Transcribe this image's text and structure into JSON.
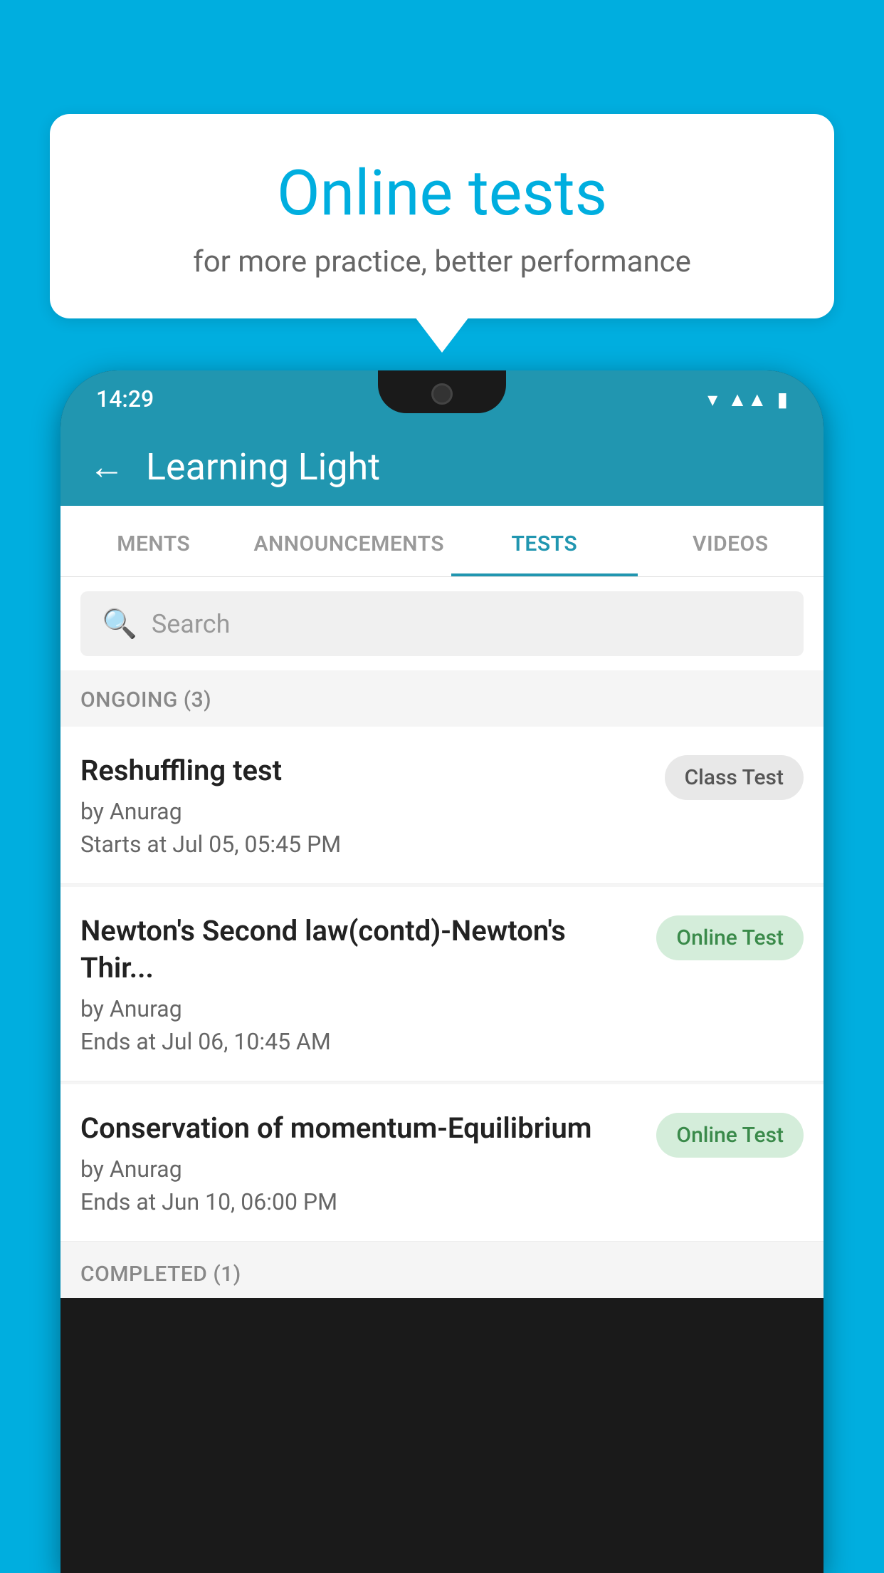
{
  "background": {
    "color": "#00AEDF"
  },
  "speech_bubble": {
    "title": "Online tests",
    "subtitle": "for more practice, better performance"
  },
  "phone": {
    "status_bar": {
      "time": "14:29",
      "icons": [
        "wifi",
        "signal",
        "battery"
      ]
    },
    "app_bar": {
      "title": "Learning Light",
      "back_label": "←"
    },
    "tabs": [
      {
        "label": "MENTS",
        "active": false
      },
      {
        "label": "ANNOUNCEMENTS",
        "active": false
      },
      {
        "label": "TESTS",
        "active": true
      },
      {
        "label": "VIDEOS",
        "active": false
      }
    ],
    "search": {
      "placeholder": "Search",
      "icon": "🔍"
    },
    "ongoing_section": {
      "label": "ONGOING (3)",
      "items": [
        {
          "title": "Reshuffling test",
          "by": "by Anurag",
          "time": "Starts at  Jul 05, 05:45 PM",
          "badge": "Class Test",
          "badge_type": "class"
        },
        {
          "title": "Newton's Second law(contd)-Newton's Thir...",
          "by": "by Anurag",
          "time": "Ends at  Jul 06, 10:45 AM",
          "badge": "Online Test",
          "badge_type": "online"
        },
        {
          "title": "Conservation of momentum-Equilibrium",
          "by": "by Anurag",
          "time": "Ends at  Jun 10, 06:00 PM",
          "badge": "Online Test",
          "badge_type": "online"
        }
      ]
    },
    "completed_section": {
      "label": "COMPLETED (1)"
    }
  }
}
